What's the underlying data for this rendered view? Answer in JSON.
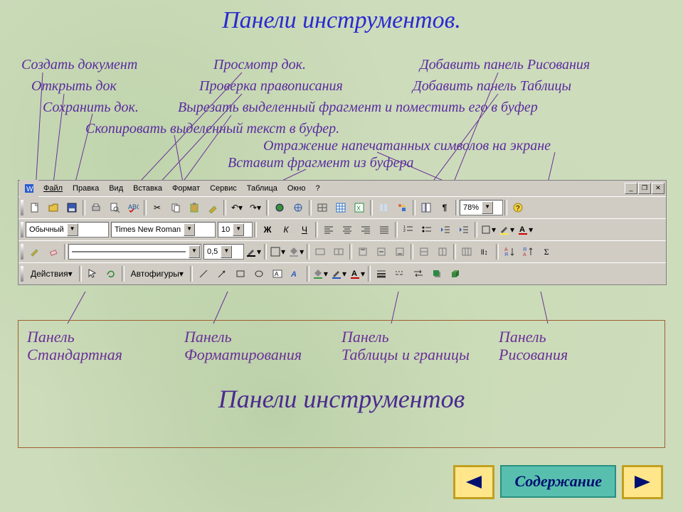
{
  "title": "Панели инструментов.",
  "annotations": {
    "create": "Создать документ",
    "open": "Открыть док",
    "save": "Сохранить док.",
    "copy": "Скопировать выделенный текст в буфер.",
    "preview": "Просмотр док.",
    "spell": "Проверка правописания",
    "cut": "Вырезать выделенный фрагмент и поместить его в буфер",
    "reflect": "Отражение напечатанных символов на экране",
    "paste": "Вставит фрагмент из буфера",
    "drawing_panel": "Добавить панель Рисования",
    "table_panel": "Добавить панель Таблицы"
  },
  "menu": [
    "Файл",
    "Правка",
    "Вид",
    "Вставка",
    "Формат",
    "Сервис",
    "Таблица",
    "Окно",
    "?"
  ],
  "std": {
    "zoom": "78%"
  },
  "fmt": {
    "style": "Обычный",
    "font": "Times New Roman",
    "size": "10"
  },
  "tables": {
    "weight": "0,5"
  },
  "draw": {
    "actions": "Действия",
    "autoshapes": "Автофигуры"
  },
  "panels": {
    "a": "Панель\nСтандартная",
    "b": "Панель\nФорматирования",
    "c": "Панель\nТаблицы и границы",
    "d": "Панель\nРисования",
    "heading": "Панели инструментов"
  },
  "nav": {
    "contents": "Содержание"
  }
}
